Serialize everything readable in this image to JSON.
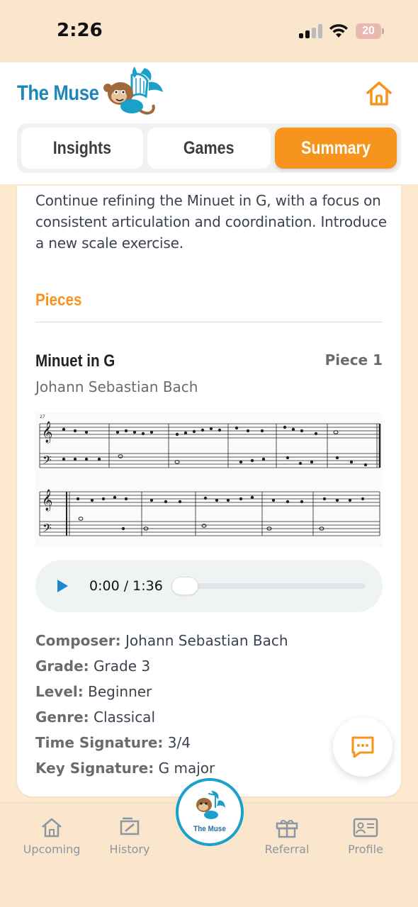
{
  "status": {
    "time": "2:26",
    "battery": "20"
  },
  "header": {
    "title": "The Muse"
  },
  "tabs": [
    {
      "label": "Insights",
      "active": false
    },
    {
      "label": "Games",
      "active": false
    },
    {
      "label": "Summary",
      "active": true
    }
  ],
  "summary": {
    "intro": "Continue refining the Minuet in G, with a focus on consistent articulation and coordination. Introduce a new scale exercise.",
    "section_title": "Pieces",
    "piece": {
      "title": "Minuet in G",
      "number": "Piece 1",
      "composer": "Johann Sebastian Bach",
      "measure_label": "27",
      "player": {
        "time": "0:00 / 1:36",
        "progress": 0
      },
      "details": [
        {
          "key": "Composer:",
          "value": "Johann Sebastian Bach"
        },
        {
          "key": "Grade:",
          "value": "Grade 3"
        },
        {
          "key": "Level:",
          "value": "Beginner"
        },
        {
          "key": "Genre:",
          "value": "Classical"
        },
        {
          "key": "Time Signature:",
          "value": "3/4"
        },
        {
          "key": "Key Signature:",
          "value": "G major"
        }
      ]
    }
  },
  "bottom_nav": {
    "upcoming": "Upcoming",
    "history": "History",
    "center": "The Muse",
    "referral": "Referral",
    "profile": "Profile"
  },
  "colors": {
    "accent": "#f7941d",
    "brand": "#1f86b8",
    "nav_inactive": "#8c96a0"
  }
}
